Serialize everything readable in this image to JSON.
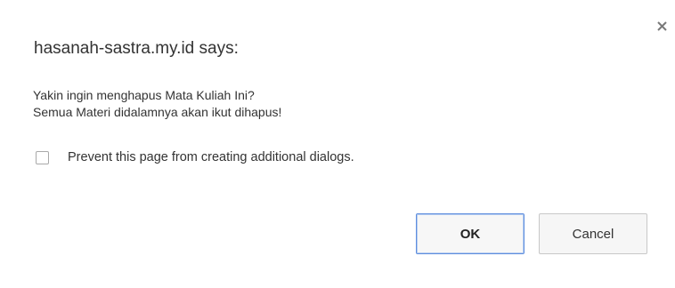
{
  "dialog": {
    "title": "hasanah-sastra.my.id says:",
    "close_icon": "close-icon",
    "message_line1": "Yakin ingin menghapus Mata Kuliah Ini?",
    "message_line2": "Semua Materi didalamnya akan ikut dihapus!",
    "prevent_label": "Prevent this page from creating additional dialogs.",
    "prevent_checked": false,
    "ok_label": "OK",
    "cancel_label": "Cancel",
    "colors": {
      "text": "#333333",
      "ok_border": "#5e8ede",
      "button_border": "#c8c8c8",
      "button_bg": "#f6f6f6"
    }
  }
}
